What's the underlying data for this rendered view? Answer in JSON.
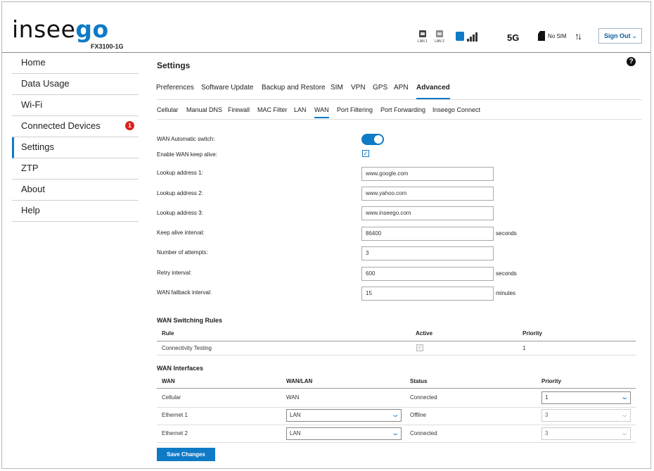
{
  "brand": {
    "logo_text": "insee",
    "logo_accent": "go",
    "model": "FX3100-1G"
  },
  "status_bar": {
    "lan1_label": "LAN 1",
    "lan2_label": "LAN 2",
    "network": "5G",
    "sim": "No SIM",
    "data_arrows": "↑↓",
    "sign_out": "Sign Out"
  },
  "sidebar": {
    "items": [
      {
        "label": "Home"
      },
      {
        "label": "Data Usage"
      },
      {
        "label": "Wi-Fi"
      },
      {
        "label": "Connected Devices",
        "badge": "1"
      },
      {
        "label": "Settings",
        "active": true
      },
      {
        "label": "ZTP"
      },
      {
        "label": "About"
      },
      {
        "label": "Help"
      }
    ]
  },
  "page": {
    "title": "Settings",
    "help": "?"
  },
  "tabs": [
    "Preferences",
    "Software Update",
    "Backup and Restore",
    "SIM",
    "VPN",
    "GPS",
    "APN",
    "Advanced"
  ],
  "active_tab": "Advanced",
  "subtabs": [
    "Cellular",
    "Manual DNS",
    "Firewall",
    "MAC Filter",
    "LAN",
    "WAN",
    "Port Filtering",
    "Port Forwarding",
    "Inseego Connect"
  ],
  "active_subtab": "WAN",
  "form": {
    "wan_auto_switch_label": "WAN Automatic switch:",
    "wan_auto_switch_on": true,
    "keep_alive_label": "Enable WAN keep alive:",
    "keep_alive_checked": true,
    "lookup1_label": "Lookup address 1:",
    "lookup1": "www.google.com",
    "lookup2_label": "Lookup address 2:",
    "lookup2": "www.yahoo.com",
    "lookup3_label": "Lookup address 3:",
    "lookup3": "www.inseego.com",
    "keep_alive_interval_label": "Keep alive interval:",
    "keep_alive_interval": "86400",
    "keep_alive_interval_unit": "seconds",
    "attempts_label": "Number of attempts:",
    "attempts": "3",
    "retry_label": "Retry interval:",
    "retry": "600",
    "retry_unit": "seconds",
    "failback_label": "WAN failback interval:",
    "failback": "15",
    "failback_unit": "minutes"
  },
  "switching_rules": {
    "title": "WAN Switching Rules",
    "headers": [
      "Rule",
      "Active",
      "Priority"
    ],
    "rows": [
      {
        "rule": "Connectivity Testing",
        "active": true,
        "priority": "1"
      }
    ]
  },
  "interfaces": {
    "title": "WAN Interfaces",
    "headers": [
      "WAN",
      "WAN/LAN",
      "Status",
      "Priority"
    ],
    "rows": [
      {
        "wan": "Cellular",
        "wanlan": "WAN",
        "status": "Connected",
        "priority": "1"
      },
      {
        "wan": "Ethernet 1",
        "wanlan": "LAN",
        "status": "Offline",
        "priority": "3"
      },
      {
        "wan": "Ethernet 2",
        "wanlan": "LAN",
        "status": "Connected",
        "priority": "3"
      }
    ]
  },
  "save_button": "Save Changes",
  "colors": {
    "accent": "#0f7ac6",
    "badge": "#d9241c"
  }
}
